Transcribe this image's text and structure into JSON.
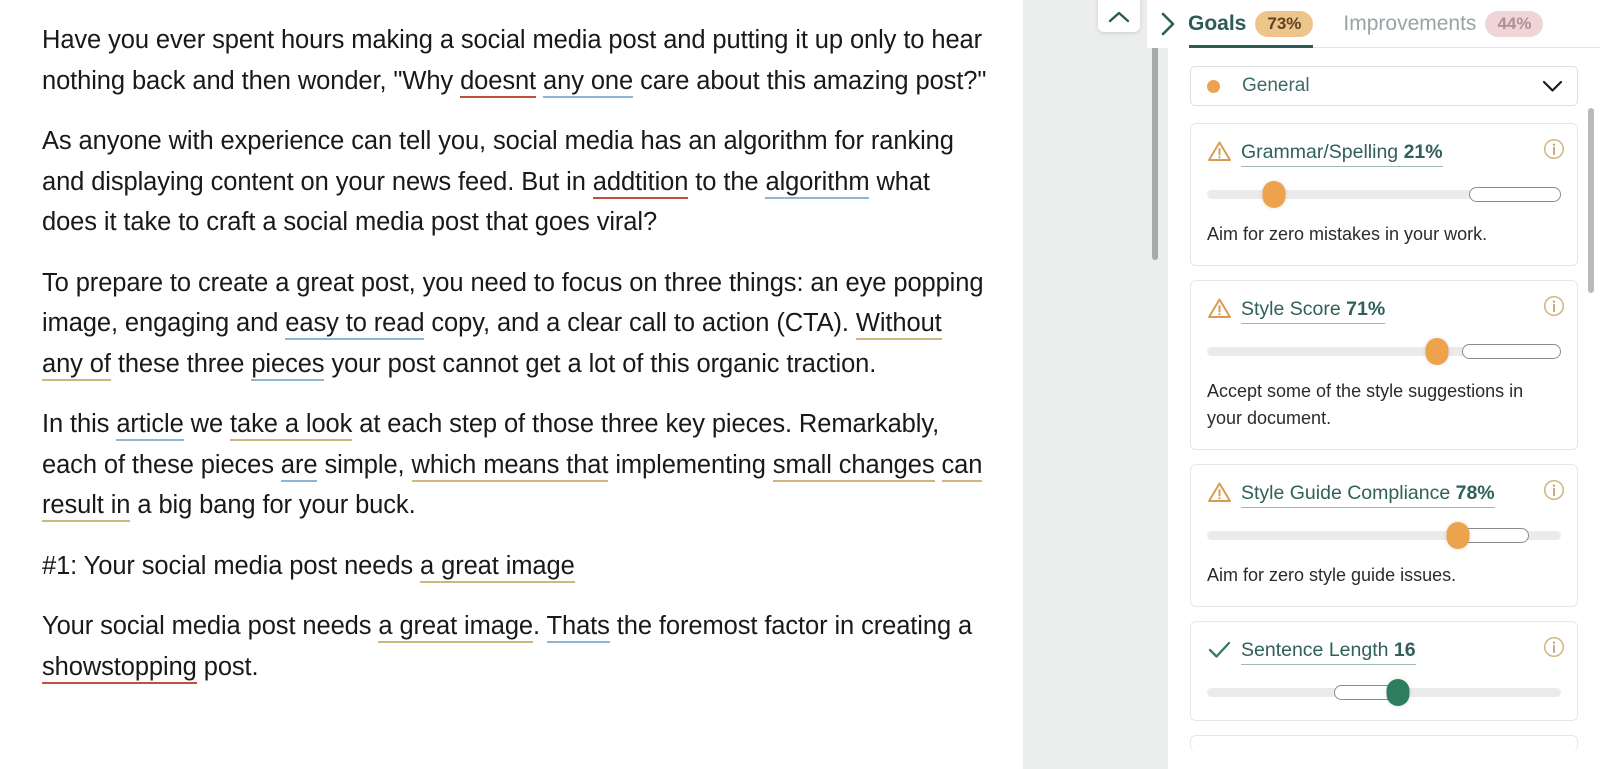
{
  "editor": {
    "paragraphs": [
      [
        {
          "t": "Have you ever spent hours making a social media post and putting it up only to hear nothing back and then wonder, \"Why "
        },
        {
          "t": "doesnt",
          "u": "spell"
        },
        {
          "t": " "
        },
        {
          "t": "any one",
          "u": "style"
        },
        {
          "t": " care about this amazing post?\""
        }
      ],
      [
        {
          "t": "As anyone with experience can tell you, social media has an algorithm for ranking and displaying content on your news feed. But in "
        },
        {
          "t": "addtition",
          "u": "spell"
        },
        {
          "t": " to the "
        },
        {
          "t": "algorithm",
          "u": "style"
        },
        {
          "t": " what does it take to craft a social media post that goes viral?"
        }
      ],
      [
        {
          "t": "To prepare to create a great post, you need to focus on three things: an eye popping image, engaging and "
        },
        {
          "t": "easy to read",
          "u": "style"
        },
        {
          "t": "  copy, and a clear call to action (CTA). "
        },
        {
          "t": "Without any of",
          "u": "guide"
        },
        {
          "t": " these three "
        },
        {
          "t": "pieces",
          "u": "style"
        },
        {
          "t": " your post cannot get a lot of this organic traction."
        }
      ],
      [
        {
          "t": "In this "
        },
        {
          "t": "article",
          "u": "style"
        },
        {
          "t": " we "
        },
        {
          "t": "take a look",
          "u": "guide"
        },
        {
          "t": " at each step of those three key pieces. Remarkably, each of these pieces "
        },
        {
          "t": "are",
          "u": "style"
        },
        {
          "t": " simple, "
        },
        {
          "t": "which means that",
          "u": "guide"
        },
        {
          "t": " implementing "
        },
        {
          "t": "small changes",
          "u": "guide"
        },
        {
          "t": " "
        },
        {
          "t": "can result in",
          "u": "guide"
        },
        {
          "t": " a big bang for your buck."
        }
      ],
      [
        {
          "t": "#1: Your social media post needs "
        },
        {
          "t": "a great image",
          "u": "guide"
        }
      ],
      [
        {
          "t": "Your social media post needs "
        },
        {
          "t": "a great image",
          "u": "guide"
        },
        {
          "t": ". "
        },
        {
          "t": "Thats",
          "u": "style"
        },
        {
          "t": " the foremost factor in creating a "
        },
        {
          "t": "showstopping",
          "u": "spell"
        },
        {
          "t": " post."
        }
      ]
    ]
  },
  "panel": {
    "tabs": [
      {
        "label": "Goals",
        "badge": "73%",
        "active": true
      },
      {
        "label": "Improvements",
        "badge": "44%",
        "active": false
      }
    ],
    "category_select": {
      "label": "General",
      "dot_color": "#eda34e",
      "chevron": "chevron-down-icon"
    },
    "goals": [
      {
        "title": "Grammar/Spelling",
        "value": "21%",
        "status": "warning",
        "description": "Aim for zero mistakes in your work.",
        "thumb_pct": 19,
        "thumb_color": "#eda34e",
        "target_start_pct": 74,
        "target_end_pct": 100
      },
      {
        "title": "Style Score",
        "value": "71%",
        "status": "warning",
        "description": "Accept some of the style suggestions in your document.",
        "thumb_pct": 65,
        "thumb_color": "#eda34e",
        "target_start_pct": 72,
        "target_end_pct": 100
      },
      {
        "title": "Style Guide Compliance",
        "value": "78%",
        "status": "warning",
        "description": "Aim for zero style guide issues.",
        "thumb_pct": 71,
        "thumb_color": "#eda34e",
        "target_start_pct": 71,
        "target_end_pct": 91
      },
      {
        "title": "Sentence Length",
        "value": "16",
        "status": "ok",
        "description": "",
        "thumb_pct": 54,
        "thumb_color": "#2f7d5f",
        "target_start_pct": 36,
        "target_end_pct": 56
      }
    ]
  },
  "controls": {
    "collapse_up": "chevron-up-icon",
    "collapse_right": "chevron-right-icon"
  },
  "colors": {
    "spelling_underline": "#bf4f3f",
    "style_underline": "#8fb4d4",
    "style_guide_underline": "#cfb57f",
    "accent_teal": "#2d5b55",
    "accent_orange": "#eda34e",
    "accent_green": "#2f7d5f"
  }
}
